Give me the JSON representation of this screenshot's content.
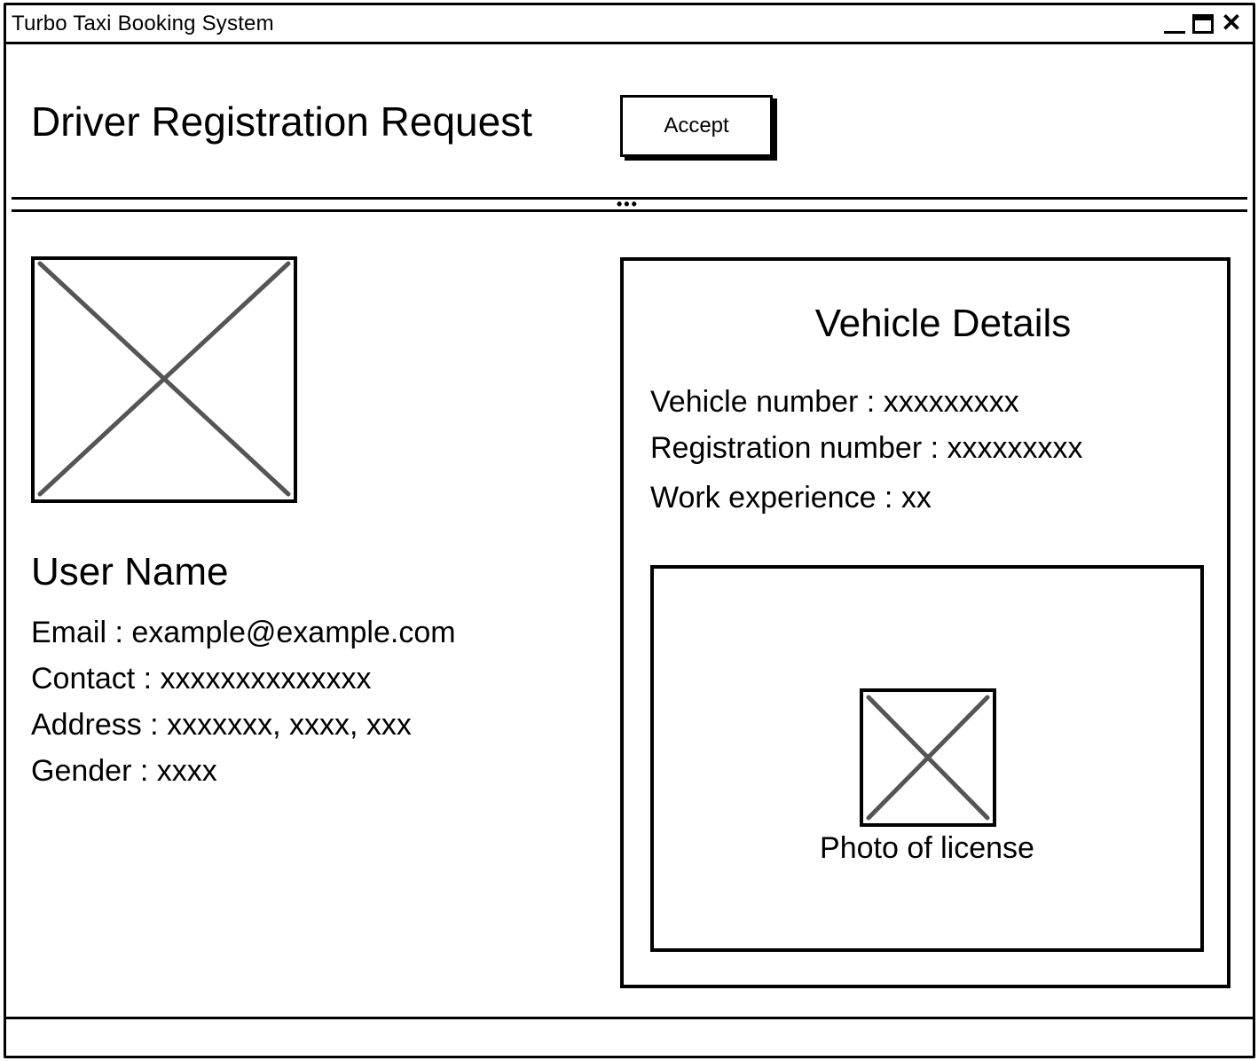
{
  "window": {
    "title": "Turbo Taxi Booking System",
    "controls": [
      "minimize-icon",
      "maximize-icon",
      "close-icon"
    ],
    "close_glyph": "✕"
  },
  "header": {
    "title": "Driver Registration Request",
    "accept_label": "Accept"
  },
  "splitter": {
    "grip": "•••"
  },
  "user": {
    "photo_icon": "image-placeholder-icon",
    "name": "User Name",
    "email": "Email : example@example.com",
    "contact": "Contact : xxxxxxxxxxxxxx",
    "address": "Address : xxxxxxx, xxxx, xxx",
    "gender": "Gender : xxxx"
  },
  "vehicle": {
    "title": "Vehicle Details",
    "vehicle_number": "Vehicle number : xxxxxxxxx",
    "registration_number": "Registration number : xxxxxxxxx",
    "work_experience": "Work experience : xx",
    "license_icon": "image-placeholder-icon",
    "license_caption": "Photo of license"
  },
  "colors": {
    "stroke": "#000000",
    "placeholder_cross": "#555555",
    "background": "#ffffff"
  }
}
